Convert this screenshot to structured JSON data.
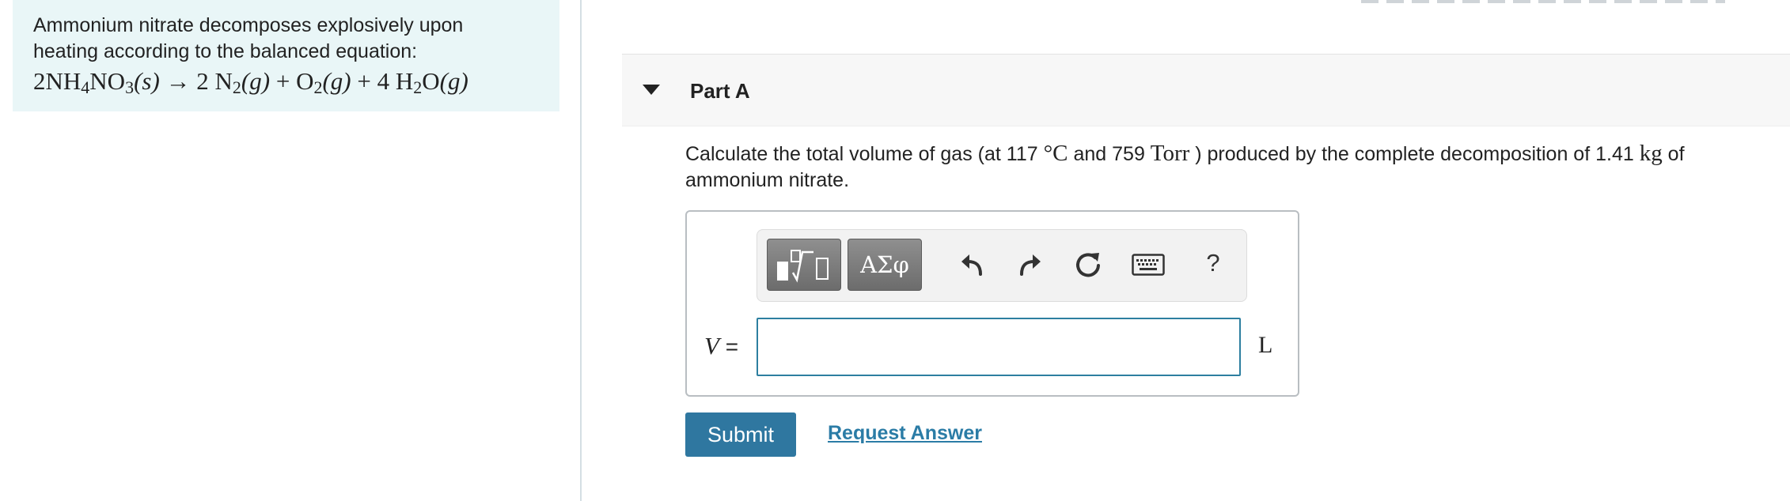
{
  "problem": {
    "intro": "Ammonium nitrate decomposes explosively upon heating according to the balanced equation:",
    "equation": {
      "reactant_coef": "2",
      "reactant": [
        "NH",
        "4",
        "NO",
        "3"
      ],
      "reactant_phase": "(s)",
      "arrow": "→",
      "p1_coef": "2",
      "p1": [
        "N",
        "2"
      ],
      "p1_phase": "(g)",
      "plus": "+",
      "p2": [
        "O",
        "2"
      ],
      "p2_phase": "(g)",
      "p3_coef": "4",
      "p3": [
        "H",
        "2",
        "O"
      ],
      "p3_phase": "(g)"
    }
  },
  "part": {
    "title": "Part A",
    "question": {
      "t1": "Calculate the total volume of gas (at 117 ",
      "temp_unit": "°C",
      "t2": " and 759 ",
      "pressure_unit": "Torr",
      "t3": " ) produced by the complete decomposition of 1.41 ",
      "mass_unit": "kg",
      "t4": " of ammonium nitrate."
    }
  },
  "toolbar": {
    "symbols_label": "ΑΣφ",
    "help_label": "?",
    "icons": [
      "templates-icon",
      "undo-icon",
      "redo-icon",
      "reset-icon",
      "keyboard-icon",
      "help-icon"
    ]
  },
  "answer": {
    "variable": "V",
    "equals": " =",
    "value": "",
    "unit": "L"
  },
  "actions": {
    "submit_label": "Submit",
    "request_answer_label": "Request Answer"
  },
  "colors": {
    "panel_bg": "#e9f6f7",
    "accent": "#2f77a0",
    "link": "#2b7ca6",
    "input_border": "#2d7fa0"
  }
}
